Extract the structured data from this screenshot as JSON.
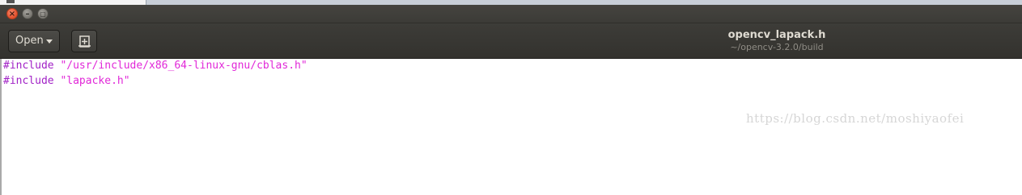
{
  "window": {
    "close_glyph": "×",
    "minimize_glyph": "–",
    "maximize_glyph": "▢"
  },
  "header": {
    "open_label": "Open",
    "new_tab_icon": "new-document-icon",
    "title": "opencv_lapack.h",
    "path": "~/opencv-3.2.0/build"
  },
  "editor": {
    "lines": [
      {
        "directive": "#include",
        "value": "\"/usr/include/x86_64-linux-gnu/cblas.h\""
      },
      {
        "directive": "#include",
        "value": "\"lapacke.h\""
      }
    ]
  },
  "watermark": {
    "text": "https://blog.csdn.net/moshiyaofei"
  },
  "colors": {
    "directive": "#a121c6",
    "string": "#e128d8",
    "titlebar": "#3c3b37",
    "close_button": "#e1502c"
  }
}
